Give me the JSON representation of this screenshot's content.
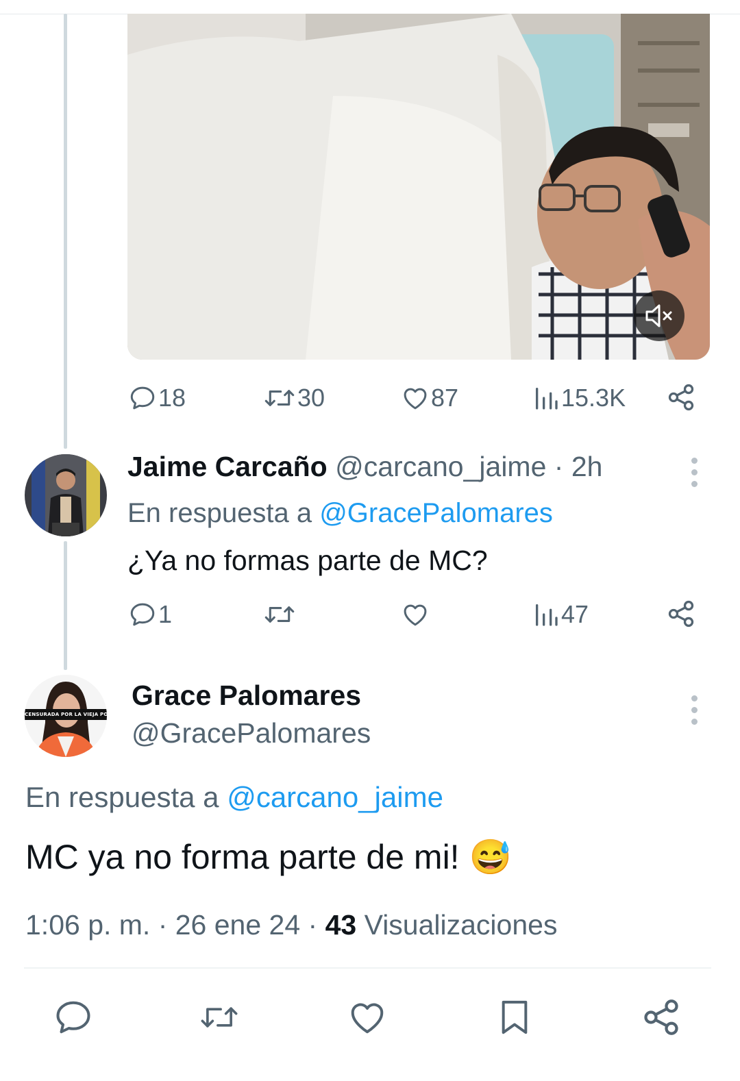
{
  "first_tweet": {
    "stats": {
      "replies": "18",
      "retweets": "30",
      "likes": "87",
      "views": "15.3K"
    }
  },
  "reply": {
    "author_name": "Jaime Carcaño",
    "handle": "@carcano_jaime",
    "separator": " · ",
    "time": "2h",
    "reply_prefix": "En respuesta a ",
    "reply_to": "@GracePalomares",
    "text": "¿Ya no formas parte de MC?",
    "stats": {
      "replies": "1",
      "retweets": "",
      "likes": "",
      "views": "47"
    }
  },
  "main_tweet": {
    "author_name": "Grace Palomares",
    "handle": "@GracePalomares",
    "avatar_banner": "CENSURADA POR LA VIEJA POLITICA",
    "reply_prefix": "En respuesta a ",
    "reply_to": "@carcano_jaime",
    "text": "MC ya no forma parte de mi! 😅",
    "timestamp": "1:06 p. m. · 26 ene 24 · ",
    "views_count": "43",
    "views_label": " Visualizaciones"
  },
  "colors": {
    "link": "#1d9bf0",
    "muted": "#536471",
    "text": "#0f1419",
    "thread_line": "#cfd9de"
  },
  "icons": [
    "reply-icon",
    "retweet-icon",
    "like-icon",
    "views-icon",
    "share-icon",
    "bookmark-icon",
    "mute-icon",
    "more-icon"
  ]
}
